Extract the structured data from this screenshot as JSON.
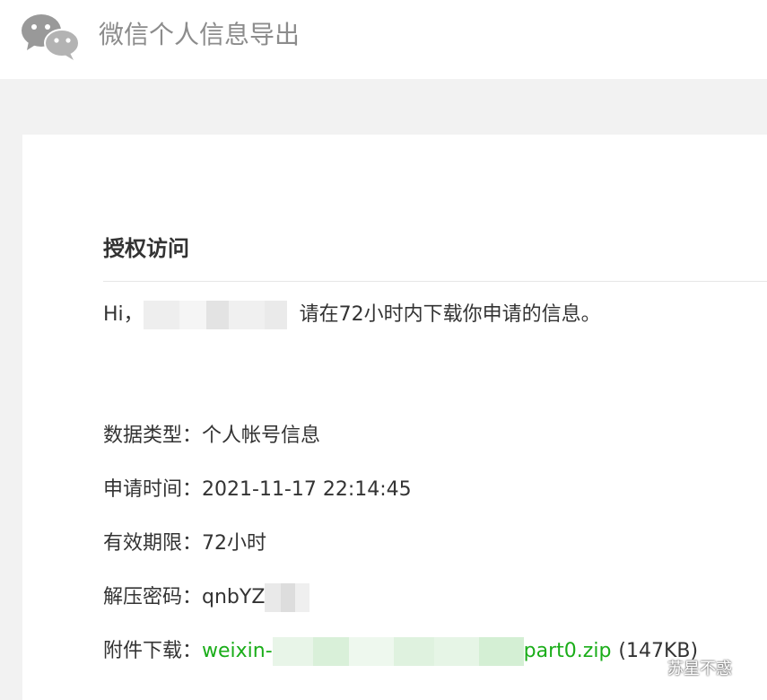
{
  "header": {
    "logo_icon": "wechat-logo-icon",
    "title": "微信个人信息导出"
  },
  "card": {
    "title": "授权访问",
    "greeting_prefix": "Hi，",
    "greeting_message": "请在72小时内下载你申请的信息。",
    "rows": {
      "data_type": {
        "label": "数据类型：",
        "value": "个人帐号信息"
      },
      "request_time": {
        "label": "申请时间：",
        "value": "2021-11-17 22:14:45"
      },
      "validity": {
        "label": "有效期限：",
        "value": "72小时"
      },
      "password": {
        "label": "解压密码：",
        "value": "qnbYZ"
      },
      "attachment": {
        "label": "附件下载：",
        "link_prefix": "weixin-",
        "link_suffix": "part0.zip",
        "size": "(147KB)"
      }
    }
  },
  "watermark": {
    "text": "苏星不惑",
    "icon": "wechat-icon"
  },
  "colors": {
    "link": "#1aad19",
    "text": "#333333",
    "header_title": "#8c8c8c",
    "background": "#f2f2f2"
  }
}
